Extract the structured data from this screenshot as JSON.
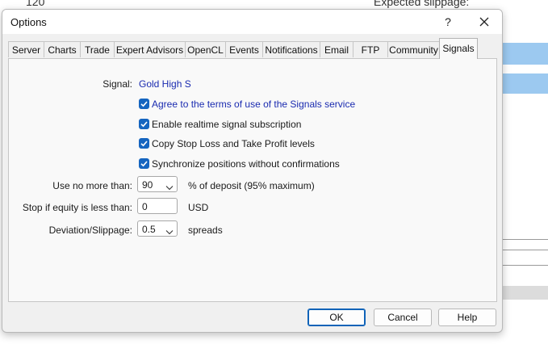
{
  "background": {
    "left_number": "120",
    "right_label": "Expected slippage:"
  },
  "dialog": {
    "title": "Options",
    "help_glyph": "?"
  },
  "tabs": [
    {
      "label": "Server"
    },
    {
      "label": "Charts"
    },
    {
      "label": "Trade"
    },
    {
      "label": "Expert Advisors"
    },
    {
      "label": "OpenCL"
    },
    {
      "label": "Events"
    },
    {
      "label": "Notifications"
    },
    {
      "label": "Email"
    },
    {
      "label": "FTP"
    },
    {
      "label": "Community"
    },
    {
      "label": "Signals",
      "active": true
    }
  ],
  "signals": {
    "signal_label": "Signal:",
    "signal_value": "Gold High S",
    "checkboxes": [
      {
        "label": "Agree to the terms of use of the Signals service",
        "checked": true
      },
      {
        "label": "Enable realtime signal subscription",
        "checked": true
      },
      {
        "label": "Copy Stop Loss and Take Profit levels",
        "checked": true
      },
      {
        "label": "Synchronize positions without confirmations",
        "checked": true
      }
    ],
    "deposit": {
      "label": "Use no more than:",
      "value": "90",
      "suffix": "% of deposit (95% maximum)"
    },
    "equity": {
      "label": "Stop if equity is less than:",
      "value": "0",
      "suffix": "USD"
    },
    "deviation": {
      "label": "Deviation/Slippage:",
      "value": "0.5",
      "suffix": "spreads"
    }
  },
  "buttons": {
    "ok": "OK",
    "cancel": "Cancel",
    "help": "Help"
  },
  "colors": {
    "accent": "#1565c0",
    "link": "#1a2bb0"
  }
}
